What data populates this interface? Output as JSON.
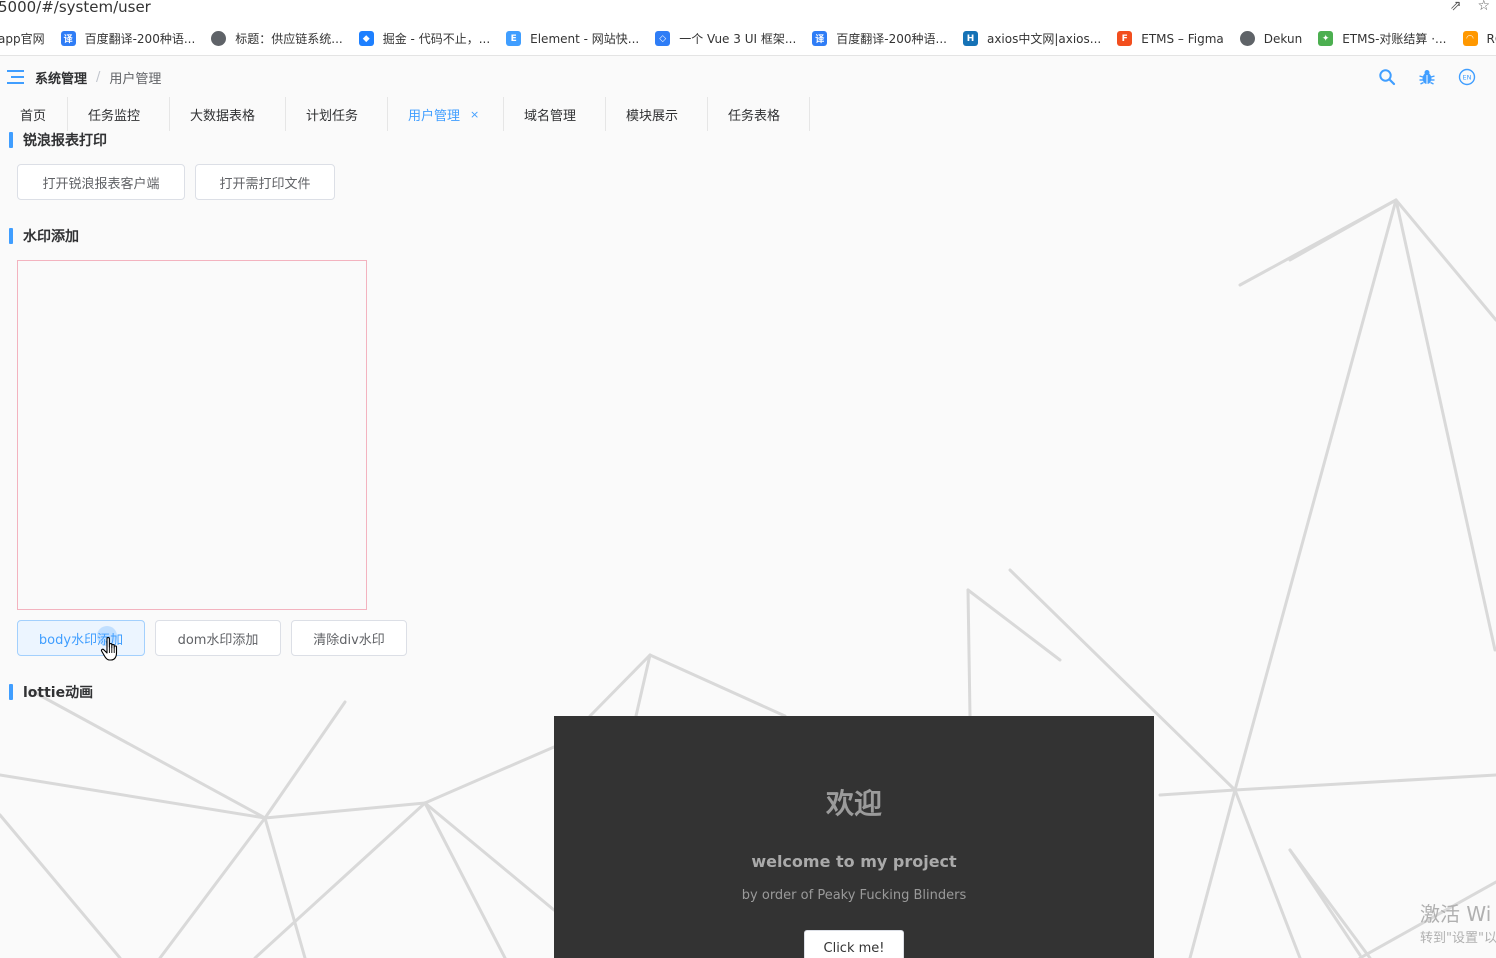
{
  "browser": {
    "url": "5000/#/system/user",
    "bookmarks": [
      {
        "label": "app官网",
        "icon": "none",
        "color": ""
      },
      {
        "label": "百度翻译-200种语...",
        "icon": "translate-icon",
        "color": "#2f7df6"
      },
      {
        "label": "标题：供应链系统...",
        "icon": "globe-icon",
        "color": "#5f6368"
      },
      {
        "label": "掘金 - 代码不止，...",
        "icon": "juejin-icon",
        "color": "#1e80ff"
      },
      {
        "label": "Element - 网站快...",
        "icon": "element-icon",
        "color": "#409eff"
      },
      {
        "label": "一个 Vue 3 UI 框架...",
        "icon": "cube-icon",
        "color": "#2f7df6"
      },
      {
        "label": "百度翻译-200种语...",
        "icon": "translate-icon",
        "color": "#2f7df6"
      },
      {
        "label": "axios中文网|axios...",
        "icon": "hex-icon",
        "color": "#1572b6"
      },
      {
        "label": "ETMS – Figma",
        "icon": "figma-icon",
        "color": "#f24e1e"
      },
      {
        "label": "Dekun",
        "icon": "globe-icon",
        "color": "#5f6368"
      },
      {
        "label": "ETMS-对账结算 ·...",
        "icon": "leaf-icon",
        "color": "#4caf50"
      },
      {
        "label": "RGB颜色",
        "icon": "rainbow-icon",
        "color": "#ff9800"
      }
    ]
  },
  "header": {
    "breadcrumb": [
      "系统管理",
      "用户管理"
    ],
    "breadcrumb_separator": "/",
    "icons": [
      "search-icon",
      "bug-icon",
      "language-icon"
    ],
    "accent": "#409eff"
  },
  "tabs": [
    {
      "label": "首页",
      "active": false
    },
    {
      "label": "任务监控",
      "active": false
    },
    {
      "label": "大数据表格",
      "active": false
    },
    {
      "label": "计划任务",
      "active": false
    },
    {
      "label": "用户管理",
      "active": true,
      "close": "×"
    },
    {
      "label": "域名管理",
      "active": false
    },
    {
      "label": "模块展示",
      "active": false
    },
    {
      "label": "任务表格",
      "active": false
    }
  ],
  "sections": {
    "report": {
      "title": "锐浪报表打印",
      "buttons": [
        "打开锐浪报表客户端",
        "打开需打印文件"
      ]
    },
    "watermark": {
      "title": "水印添加",
      "buttons": [
        "body水印添加",
        "dom水印添加",
        "清除div水印"
      ]
    },
    "lottie": {
      "title": "lottie动画"
    }
  },
  "welcome": {
    "title": "欢迎",
    "subtitle": "welcome to my project",
    "byline": "by order of Peaky Fucking Blinders",
    "button": "Click me!"
  },
  "os_watermark": {
    "line1": "激活 Wi",
    "line2": "转到\"设置\"以"
  }
}
